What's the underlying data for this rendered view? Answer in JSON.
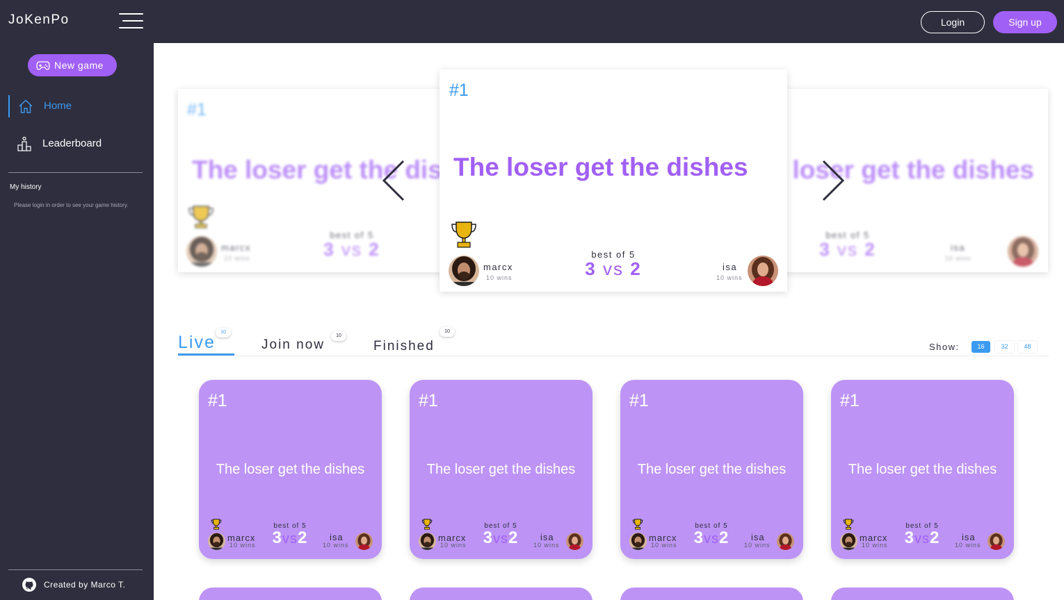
{
  "header": {
    "logo": "JoKenPo",
    "login_label": "Login",
    "signup_label": "Sign up"
  },
  "sidebar": {
    "new_game_label": "New game",
    "nav": [
      {
        "label": "Home",
        "icon": "home-icon",
        "active": true
      },
      {
        "label": "Leaderboard",
        "icon": "leaderboard-icon",
        "active": false
      }
    ],
    "history_title": "My history",
    "history_note": "Please login in order to see your game history.",
    "footer_text": "Created by Marco T."
  },
  "carousel": {
    "rank": "#1",
    "title": "The loser get the dishes",
    "best_of": "best of 5",
    "score_left": "3",
    "score_vs": "vs",
    "score_right": "2",
    "player1": {
      "name": "marcx",
      "wins": "10 wins"
    },
    "player2": {
      "name": "isa",
      "wins": "10 wins"
    }
  },
  "tabs": [
    {
      "label": "Live",
      "count": "10",
      "active": true
    },
    {
      "label": "Join now",
      "count": "10",
      "active": false
    },
    {
      "label": "Finished",
      "count": "10",
      "active": false
    }
  ],
  "pagination": {
    "label": "Show:",
    "options": [
      "16",
      "32",
      "48"
    ],
    "selected": "16"
  },
  "game_cards": [
    {
      "rank": "#1",
      "title": "The loser get the dishes",
      "best_of": "best of 5",
      "score_left": "3",
      "score_vs": "vs",
      "score_right": "2",
      "player1": {
        "name": "marcx",
        "wins": "10 wins"
      },
      "player2": {
        "name": "isa",
        "wins": "10 wins"
      }
    },
    {
      "rank": "#1",
      "title": "The loser get the dishes",
      "best_of": "best of 5",
      "score_left": "3",
      "score_vs": "vs",
      "score_right": "2",
      "player1": {
        "name": "marcx",
        "wins": "10 wins"
      },
      "player2": {
        "name": "isa",
        "wins": "10 wins"
      }
    },
    {
      "rank": "#1",
      "title": "The loser get the dishes",
      "best_of": "best of 5",
      "score_left": "3",
      "score_vs": "vs",
      "score_right": "2",
      "player1": {
        "name": "marcx",
        "wins": "10 wins"
      },
      "player2": {
        "name": "isa",
        "wins": "10 wins"
      }
    },
    {
      "rank": "#1",
      "title": "The loser get the dishes",
      "best_of": "best of 5",
      "score_left": "3",
      "score_vs": "vs",
      "score_right": "2",
      "player1": {
        "name": "marcx",
        "wins": "10 wins"
      },
      "player2": {
        "name": "isa",
        "wins": "10 wins"
      }
    }
  ],
  "colors": {
    "background_dark": "#2e2e3e",
    "accent_purple": "#a160f5",
    "card_purple": "#bd94f5",
    "accent_blue": "#3c9af0",
    "trophy_gold": "#e8b40e"
  },
  "icons": [
    "menu-icon",
    "gamepad-icon",
    "home-icon",
    "leaderboard-icon",
    "github-icon",
    "trophy-icon",
    "chevron-left-icon",
    "chevron-right-icon"
  ]
}
